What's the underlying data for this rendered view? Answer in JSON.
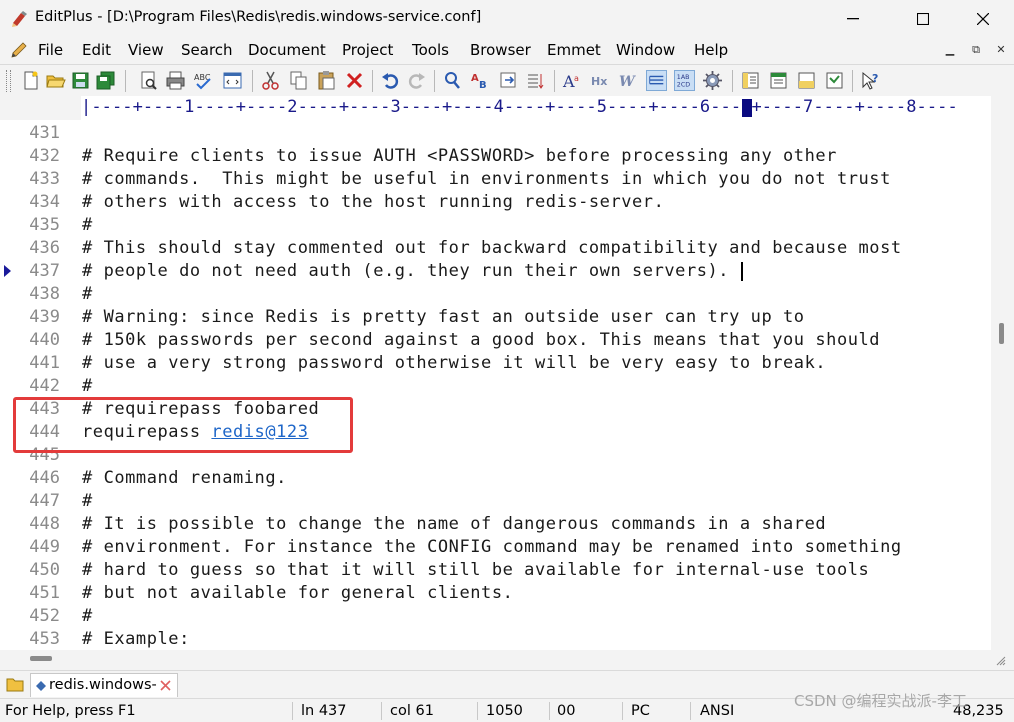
{
  "window": {
    "title": "EditPlus - [D:\\Program Files\\Redis\\redis.windows-service.conf]",
    "controls": {
      "minimize": "—",
      "maximize": "☐",
      "close": "✕"
    }
  },
  "menu": {
    "items": [
      "File",
      "Edit",
      "View",
      "Search",
      "Document",
      "Project",
      "Tools",
      "Browser",
      "Emmet",
      "Window",
      "Help"
    ]
  },
  "ruler": {
    "text": "|----+----1----+----2----+----3----+----4----+----5----+----6----+----7----+----8----",
    "color": "#1a1a8a"
  },
  "editor": {
    "lines": [
      {
        "num": "431",
        "text": ""
      },
      {
        "num": "432",
        "text": "# Require clients to issue AUTH <PASSWORD> before processing any other"
      },
      {
        "num": "433",
        "text": "# commands.  This might be useful in environments in which you do not trust"
      },
      {
        "num": "434",
        "text": "# others with access to the host running redis-server."
      },
      {
        "num": "435",
        "text": "#"
      },
      {
        "num": "436",
        "text": "# This should stay commented out for backward compatibility and because most"
      },
      {
        "num": "437",
        "text": "# people do not need auth (e.g. they run their own servers)."
      },
      {
        "num": "438",
        "text": "#"
      },
      {
        "num": "439",
        "text": "# Warning: since Redis is pretty fast an outside user can try up to"
      },
      {
        "num": "440",
        "text": "# 150k passwords per second against a good box. This means that you should"
      },
      {
        "num": "441",
        "text": "# use a very strong password otherwise it will be very easy to break."
      },
      {
        "num": "442",
        "text": "#"
      },
      {
        "num": "443",
        "text": "# requirepass foobared"
      },
      {
        "num": "444",
        "text": "requirepass ",
        "link": "redis@123"
      },
      {
        "num": "445",
        "text": ""
      },
      {
        "num": "446",
        "text": "# Command renaming."
      },
      {
        "num": "447",
        "text": "#"
      },
      {
        "num": "448",
        "text": "# It is possible to change the name of dangerous commands in a shared"
      },
      {
        "num": "449",
        "text": "# environment. For instance the CONFIG command may be renamed into something"
      },
      {
        "num": "450",
        "text": "# hard to guess so that it will still be available for internal-use tools"
      },
      {
        "num": "451",
        "text": "# but not available for general clients."
      },
      {
        "num": "452",
        "text": "#"
      },
      {
        "num": "453",
        "text": "# Example:"
      }
    ],
    "link_color": "#1e66c8",
    "highlight_color": "#e33b3b"
  },
  "tab": {
    "label": "redis.windows-"
  },
  "status": {
    "help": "For Help, press F1",
    "line": "ln 437",
    "col": "col 61",
    "total": "1050",
    "code": "00",
    "mode": "PC",
    "encoding": "ANSI",
    "size": "48,235"
  },
  "watermark": "CSDN @编程实战派-李工",
  "icons": {
    "toolbar": [
      "new-file-icon",
      "open-folder-icon",
      "save-icon",
      "save-all-icon",
      "print-preview-icon",
      "print-icon",
      "spell-check-icon",
      "browser-preview-icon",
      "cut-icon",
      "copy-icon",
      "paste-icon",
      "delete-icon",
      "undo-icon",
      "redo-icon",
      "find-icon",
      "replace-icon",
      "goto-icon",
      "word-wrap-icon",
      "font-icon",
      "hex-icon",
      "wordwrap-w-icon",
      "ruler-toggle-icon",
      "line-number-icon",
      "settings-gear-icon",
      "document-list-icon",
      "cliptext-icon",
      "output-window-icon",
      "directory-icon",
      "help-icon"
    ]
  }
}
